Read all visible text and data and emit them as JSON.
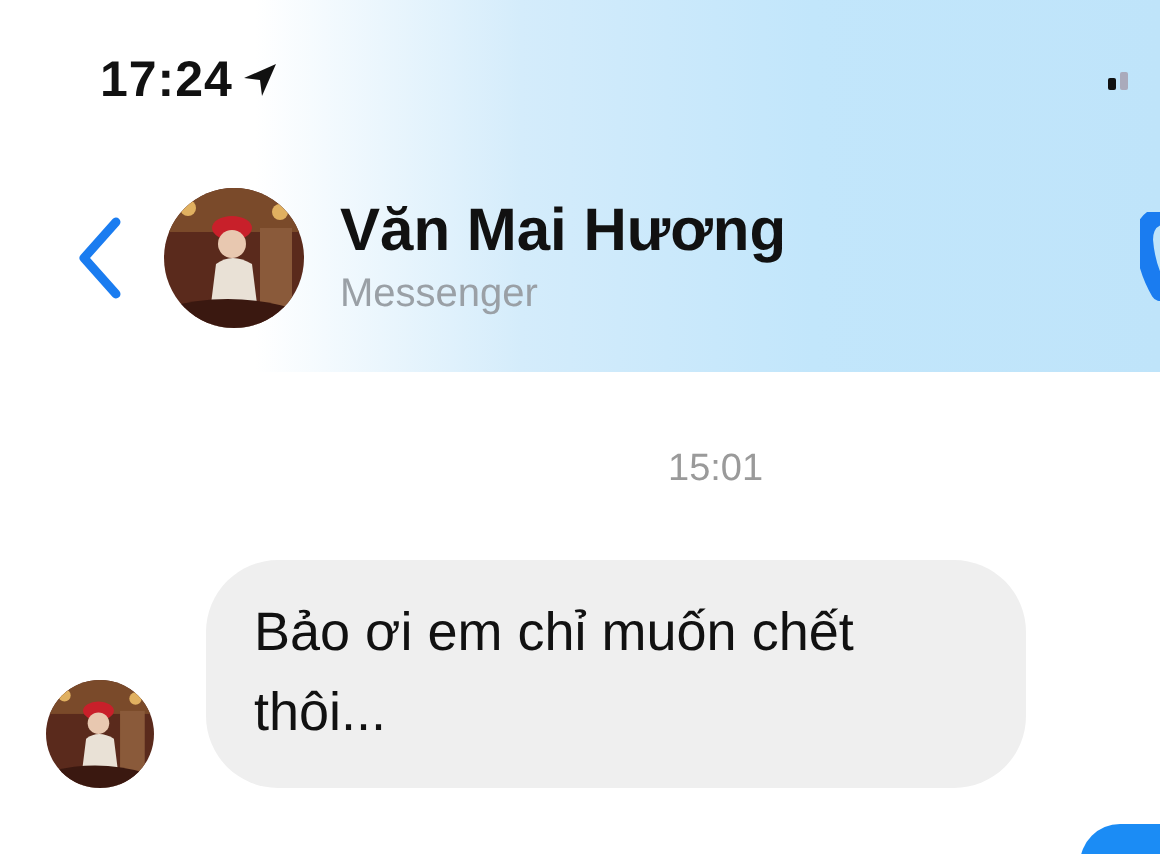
{
  "status_bar": {
    "time": "17:24"
  },
  "header": {
    "contact_name": "Văn Mai Hương",
    "subtitle": "Messenger"
  },
  "messages": [
    {
      "kind": "timestamp",
      "text": "15:01"
    },
    {
      "kind": "incoming",
      "text": "Bảo ơi em chỉ muốn chết thôi..."
    },
    {
      "kind": "outgoing_cut"
    }
  ]
}
